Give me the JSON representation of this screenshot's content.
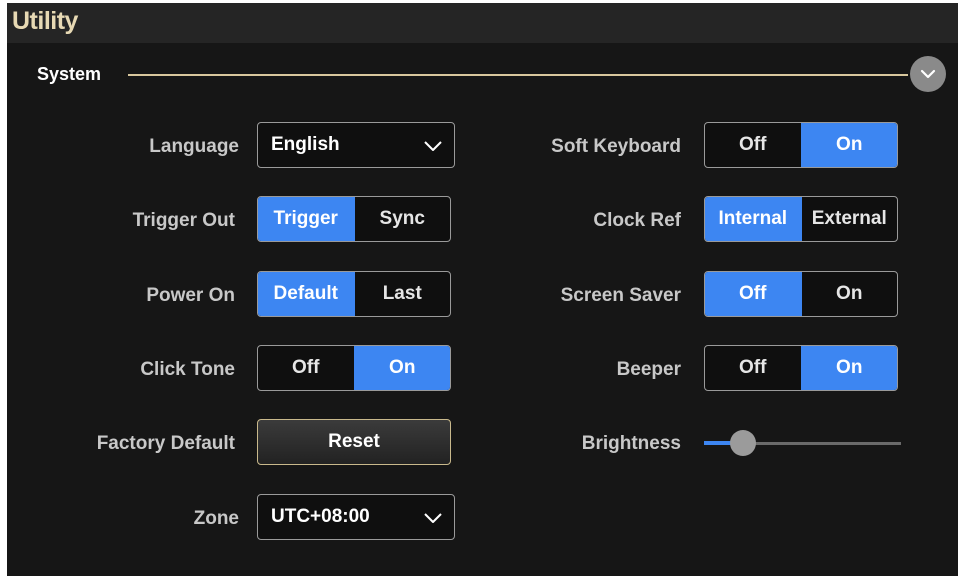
{
  "title": "Utility",
  "section": {
    "label": "System",
    "collapse_icon": "chevron-down-icon"
  },
  "left": {
    "language": {
      "label": "Language",
      "value": "English"
    },
    "trigger_out": {
      "label": "Trigger Out",
      "options": [
        "Trigger",
        "Sync"
      ],
      "active": 0
    },
    "power_on": {
      "label": "Power On",
      "options": [
        "Default",
        "Last"
      ],
      "active": 0
    },
    "click_tone": {
      "label": "Click Tone",
      "options": [
        "Off",
        "On"
      ],
      "active": 1
    },
    "factory_default": {
      "label": "Factory Default",
      "button": "Reset"
    },
    "zone": {
      "label": "Zone",
      "value": "UTC+08:00"
    }
  },
  "right": {
    "soft_keyboard": {
      "label": "Soft Keyboard",
      "options": [
        "Off",
        "On"
      ],
      "active": 1
    },
    "clock_ref": {
      "label": "Clock Ref",
      "options": [
        "Internal",
        "External"
      ],
      "active": 0
    },
    "screen_saver": {
      "label": "Screen Saver",
      "options": [
        "Off",
        "On"
      ],
      "active": 0
    },
    "beeper": {
      "label": "Beeper",
      "options": [
        "Off",
        "On"
      ],
      "active": 1
    },
    "brightness": {
      "label": "Brightness",
      "level": 0.2
    }
  },
  "colors": {
    "accent": "#3d86f2",
    "title": "#e7d9b4",
    "section_line": "#d8c79d"
  }
}
